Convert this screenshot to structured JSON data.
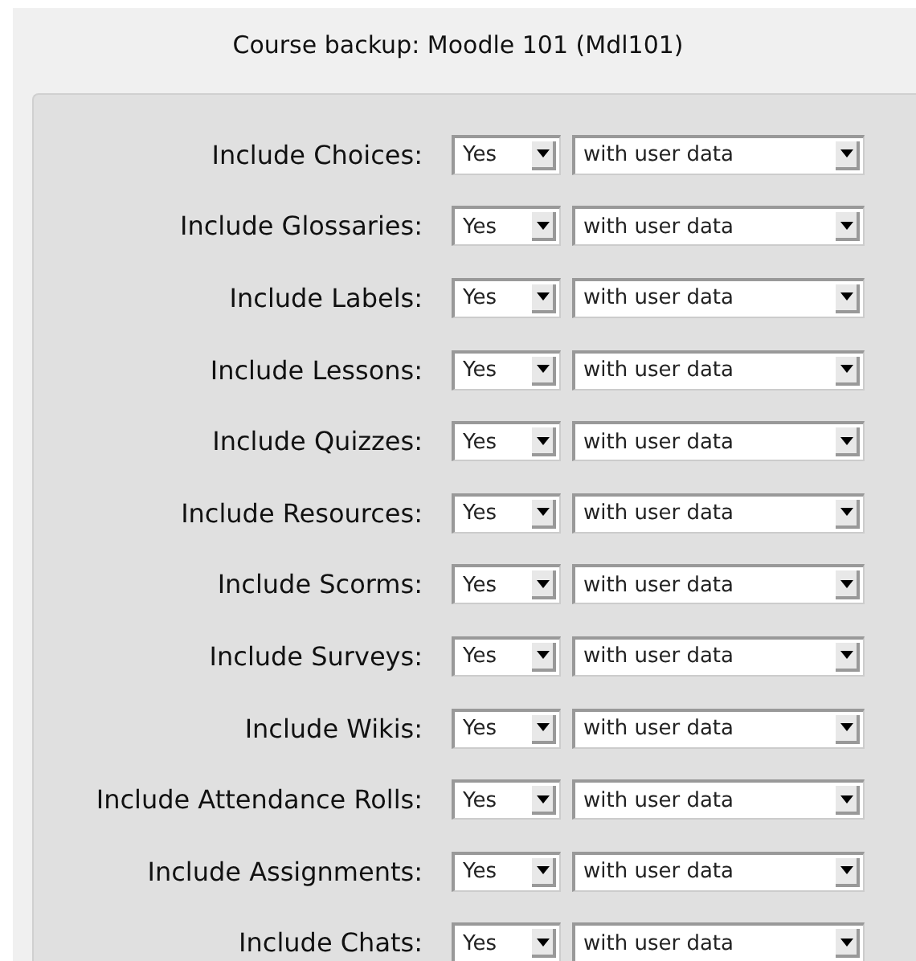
{
  "title": "Course backup: Moodle 101 (Mdl101)",
  "rows": [
    {
      "label": "Include Choices:",
      "include": "Yes",
      "userdata": "with user data"
    },
    {
      "label": "Include Glossaries:",
      "include": "Yes",
      "userdata": "with user data"
    },
    {
      "label": "Include Labels:",
      "include": "Yes",
      "userdata": "with user data"
    },
    {
      "label": "Include Lessons:",
      "include": "Yes",
      "userdata": "with user data"
    },
    {
      "label": "Include Quizzes:",
      "include": "Yes",
      "userdata": "with user data"
    },
    {
      "label": "Include Resources:",
      "include": "Yes",
      "userdata": "with user data"
    },
    {
      "label": "Include Scorms:",
      "include": "Yes",
      "userdata": "with user data"
    },
    {
      "label": "Include Surveys:",
      "include": "Yes",
      "userdata": "with user data"
    },
    {
      "label": "Include Wikis:",
      "include": "Yes",
      "userdata": "with user data"
    },
    {
      "label": "Include Attendance Rolls:",
      "include": "Yes",
      "userdata": "with user data"
    },
    {
      "label": "Include Assignments:",
      "include": "Yes",
      "userdata": "with user data"
    },
    {
      "label": "Include Chats:",
      "include": "Yes",
      "userdata": "with user data"
    }
  ]
}
